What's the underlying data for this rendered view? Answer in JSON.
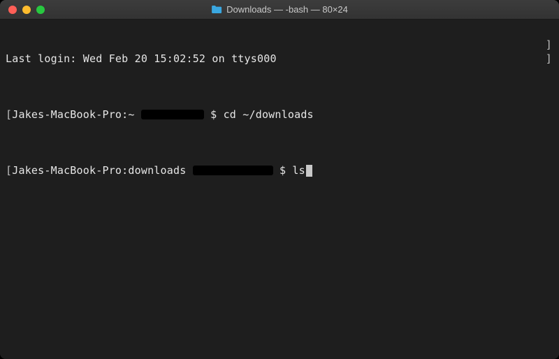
{
  "titlebar": {
    "title": "Downloads — -bash — 80×24"
  },
  "terminal": {
    "last_login": "Last login: Wed Feb 20 15:02:52 on ttys000",
    "line1": {
      "open_bracket": "[",
      "prompt_host": "Jakes-MacBook-Pro:~ ",
      "prompt_symbol": "$ ",
      "command": "cd ~/downloads"
    },
    "line2": {
      "open_bracket": "[",
      "prompt_host": "Jakes-MacBook-Pro:downloads ",
      "prompt_symbol": "$ ",
      "command": "ls"
    },
    "right_brackets": {
      "line1": "]",
      "line2": "]"
    }
  }
}
